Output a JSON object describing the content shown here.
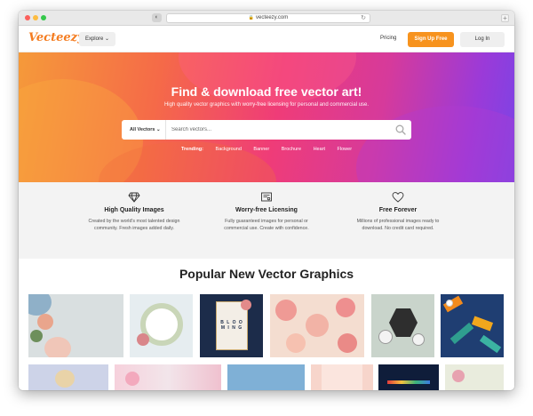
{
  "browser": {
    "url": "vecteezy.com",
    "shield_glyph": "◐",
    "reload_glyph": "↻",
    "newtab_glyph": "+"
  },
  "header": {
    "logo": "Vecteezy",
    "explore_label": "Explore ⌄",
    "pricing_label": "Pricing",
    "signup_label": "Sign Up Free",
    "login_label": "Log In"
  },
  "hero": {
    "title": "Find & download free vector art!",
    "subtitle": "High quality vector graphics with worry-free licensing for personal and commercial use.",
    "search_select": "All Vectors ⌄",
    "search_placeholder": "Search vectors...",
    "trending_label": "Trending:",
    "trending": [
      "Background",
      "Banner",
      "Brochure",
      "Heart",
      "Flower"
    ]
  },
  "features": [
    {
      "icon": "diamond-icon",
      "title": "High Quality Images",
      "desc1": "Created by the world's most talented design",
      "desc2": "community. Fresh images added daily."
    },
    {
      "icon": "license-icon",
      "title": "Worry-free Licensing",
      "desc1": "Fully guaranteed images for personal or",
      "desc2": "commercial use. Create with confidence."
    },
    {
      "icon": "heart-icon",
      "title": "Free Forever",
      "desc1": "Millions of professional images ready to",
      "desc2": "download. No credit card required."
    }
  ],
  "popular": {
    "title": "Popular New Vector Graphics"
  },
  "thumb_text": {
    "blooming": "B L O O M I N G"
  },
  "colors": {
    "accent": "#f7931e",
    "logo": "#f47c20"
  }
}
